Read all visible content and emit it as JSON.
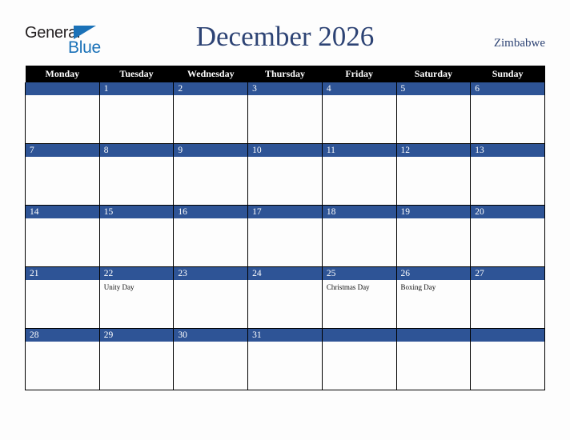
{
  "logo": {
    "word_one": "General",
    "word_two": "Blue",
    "triangle_icon": "triangle-icon",
    "brand_blue": "#1b72b8",
    "brand_dark": "#231f20"
  },
  "header": {
    "title": "December 2026",
    "country": "Zimbabwe",
    "title_color": "#2d4374"
  },
  "calendar": {
    "weekday_headers": [
      "Monday",
      "Tuesday",
      "Wednesday",
      "Thursday",
      "Friday",
      "Saturday",
      "Sunday"
    ],
    "header_bg": "#000000",
    "day_band_bg": "#2e5496",
    "weeks": [
      [
        {
          "day": "",
          "holiday": ""
        },
        {
          "day": "1",
          "holiday": ""
        },
        {
          "day": "2",
          "holiday": ""
        },
        {
          "day": "3",
          "holiday": ""
        },
        {
          "day": "4",
          "holiday": ""
        },
        {
          "day": "5",
          "holiday": ""
        },
        {
          "day": "6",
          "holiday": ""
        }
      ],
      [
        {
          "day": "7",
          "holiday": ""
        },
        {
          "day": "8",
          "holiday": ""
        },
        {
          "day": "9",
          "holiday": ""
        },
        {
          "day": "10",
          "holiday": ""
        },
        {
          "day": "11",
          "holiday": ""
        },
        {
          "day": "12",
          "holiday": ""
        },
        {
          "day": "13",
          "holiday": ""
        }
      ],
      [
        {
          "day": "14",
          "holiday": ""
        },
        {
          "day": "15",
          "holiday": ""
        },
        {
          "day": "16",
          "holiday": ""
        },
        {
          "day": "17",
          "holiday": ""
        },
        {
          "day": "18",
          "holiday": ""
        },
        {
          "day": "19",
          "holiday": ""
        },
        {
          "day": "20",
          "holiday": ""
        }
      ],
      [
        {
          "day": "21",
          "holiday": ""
        },
        {
          "day": "22",
          "holiday": "Unity Day"
        },
        {
          "day": "23",
          "holiday": ""
        },
        {
          "day": "24",
          "holiday": ""
        },
        {
          "day": "25",
          "holiday": "Christmas Day"
        },
        {
          "day": "26",
          "holiday": "Boxing Day"
        },
        {
          "day": "27",
          "holiday": ""
        }
      ],
      [
        {
          "day": "28",
          "holiday": ""
        },
        {
          "day": "29",
          "holiday": ""
        },
        {
          "day": "30",
          "holiday": ""
        },
        {
          "day": "31",
          "holiday": ""
        },
        {
          "day": "",
          "holiday": ""
        },
        {
          "day": "",
          "holiday": ""
        },
        {
          "day": "",
          "holiday": ""
        }
      ]
    ]
  }
}
